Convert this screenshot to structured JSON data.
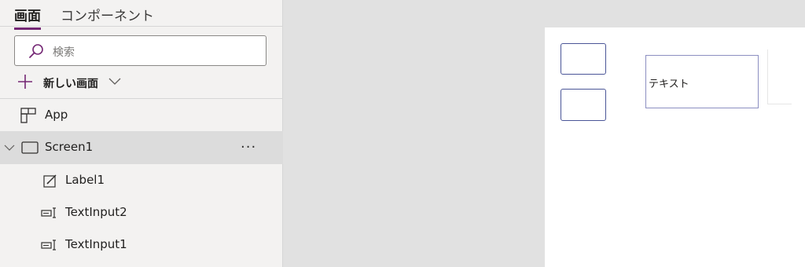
{
  "tabs": {
    "screens": "画面",
    "components": "コンポーネント"
  },
  "search": {
    "placeholder": "検索",
    "icon": "search-icon"
  },
  "new_screen": {
    "label": "新しい画面"
  },
  "tree": {
    "app": {
      "label": "App",
      "icon": "app-icon"
    },
    "screen": {
      "label": "Screen1",
      "more": "···",
      "icon": "screen-icon"
    },
    "children": [
      {
        "label": "Label1",
        "icon": "label-edit-icon"
      },
      {
        "label": "TextInput2",
        "icon": "text-input-icon"
      },
      {
        "label": "TextInput1",
        "icon": "text-input-icon"
      }
    ]
  },
  "canvas": {
    "label_text": "テキスト"
  },
  "colors": {
    "accent": "#742774",
    "control_border": "#4a5597",
    "panel_bg": "#f3f2f1",
    "workspace_bg": "#e1e1e1"
  }
}
